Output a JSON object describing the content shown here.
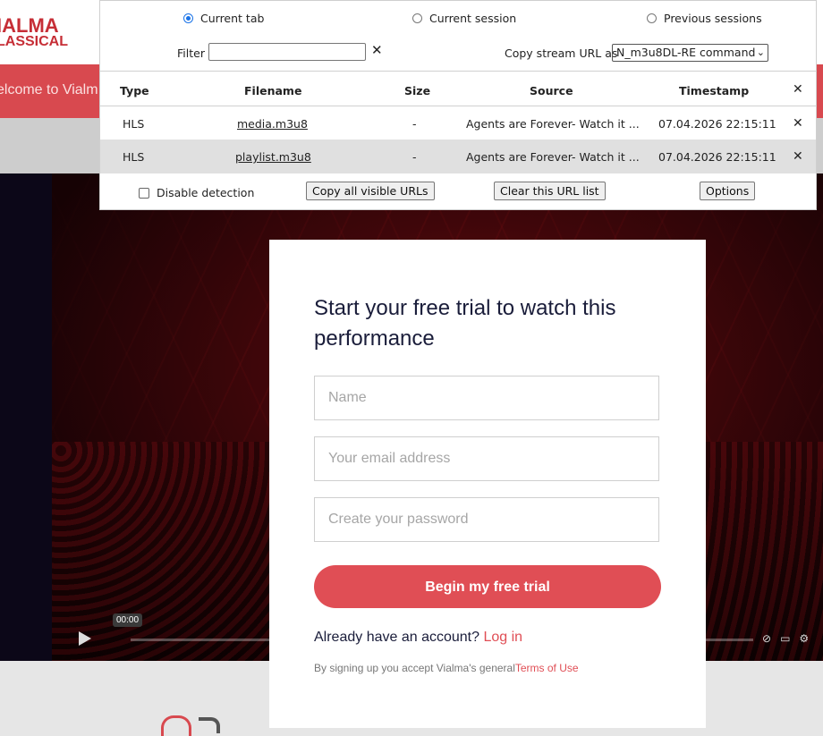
{
  "site": {
    "logo_line1": "IALMA",
    "logo_line2": "LASSICAL",
    "welcome_text": "elcome to Vialm"
  },
  "player": {
    "time_label": "00:00"
  },
  "signup": {
    "title": "Start your free trial to watch this performance",
    "name_placeholder": "Name",
    "email_placeholder": "Your email address",
    "password_placeholder": "Create your password",
    "cta_label": "Begin my free trial",
    "login_prompt": "Already have an account?",
    "login_link": "Log in",
    "terms_prefix": "By signing up you accept Vialma's general",
    "terms_link": "Terms of Use"
  },
  "popup": {
    "scope_options": [
      {
        "label": "Current tab",
        "selected": true
      },
      {
        "label": "Current session",
        "selected": false
      },
      {
        "label": "Previous sessions",
        "selected": false
      }
    ],
    "filter_label": "Filter",
    "filter_value": "",
    "filter_clear": "✕",
    "copy_label": "Copy stream URL as",
    "copy_selected": "N_m3u8DL-RE command",
    "columns": [
      "Type",
      "Filename",
      "Size",
      "Source",
      "Timestamp"
    ],
    "rows": [
      {
        "type": "HLS",
        "filename": "media.m3u8",
        "size": "-",
        "source": "Agents are Forever- Watch it ...",
        "timestamp": "07.04.2026 22:15:11"
      },
      {
        "type": "HLS",
        "filename": "playlist.m3u8",
        "size": "-",
        "source": "Agents are Forever- Watch it ...",
        "timestamp": "07.04.2026 22:15:11"
      }
    ],
    "close_symbol": "✕",
    "disable_detection_label": "Disable detection",
    "copy_all_label": "Copy all visible URLs",
    "clear_list_label": "Clear this URL list",
    "options_label": "Options"
  },
  "colors": {
    "brand_red": "#e04e55",
    "radio_blue": "#1a73e8"
  }
}
